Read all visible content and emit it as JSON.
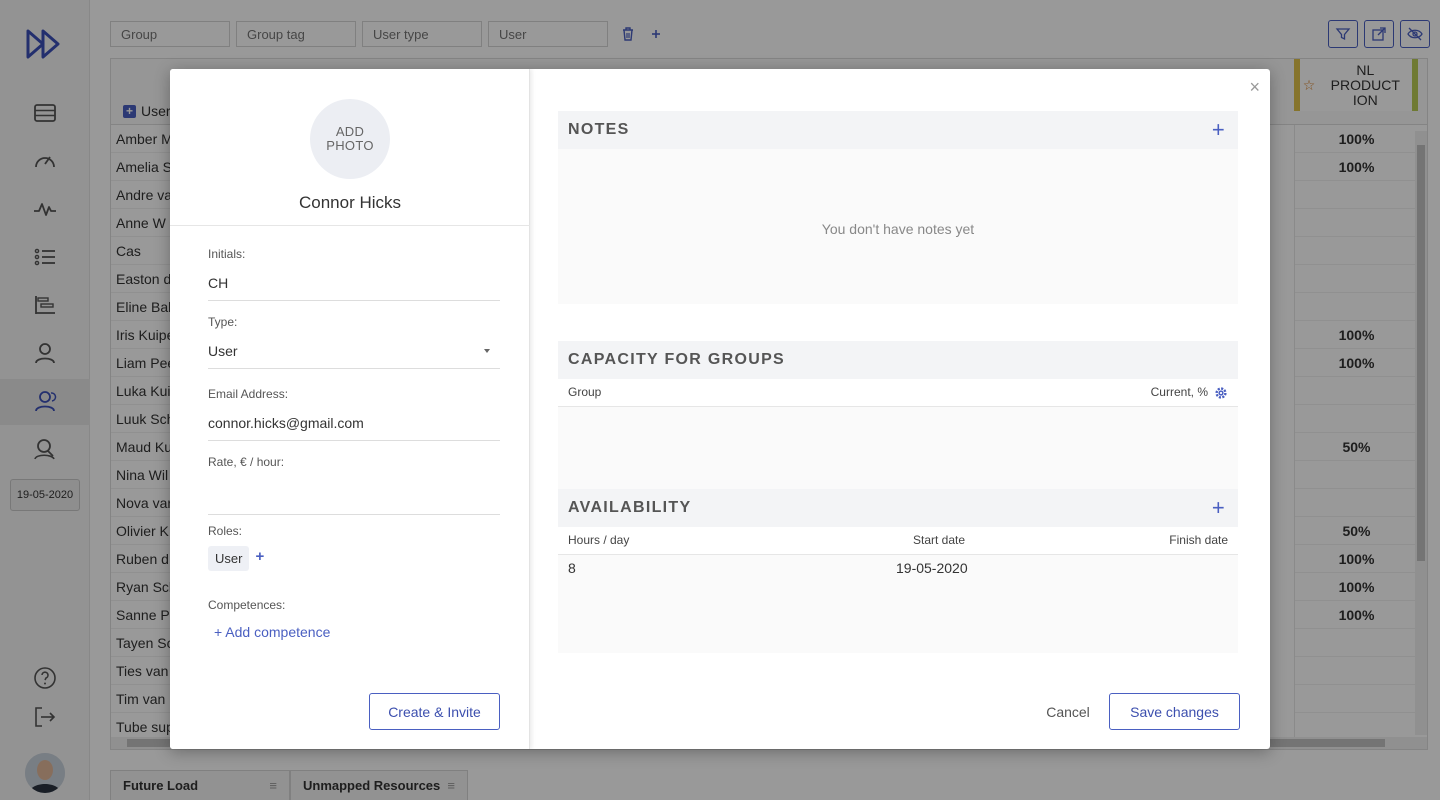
{
  "rail": {
    "date": "19-05-2020"
  },
  "toolbar": {
    "filters": [
      {
        "placeholder": "Group"
      },
      {
        "placeholder": "Group tag"
      },
      {
        "placeholder": "User type"
      },
      {
        "placeholder": "User"
      }
    ]
  },
  "grid": {
    "user_header": "User",
    "right_column_header": "NL PRODUCT ION",
    "rows": [
      {
        "name": "Amber M",
        "value": "100%"
      },
      {
        "name": "Amelia S",
        "value": "100%"
      },
      {
        "name": "Andre va",
        "value": ""
      },
      {
        "name": "Anne W",
        "value": ""
      },
      {
        "name": "Cas",
        "value": ""
      },
      {
        "name": "Easton d",
        "value": ""
      },
      {
        "name": "Eline Bak",
        "value": ""
      },
      {
        "name": "Iris Kuipe",
        "value": "100%"
      },
      {
        "name": "Liam Pee",
        "value": "100%"
      },
      {
        "name": "Luka Kui",
        "value": ""
      },
      {
        "name": "Luuk Sch",
        "value": ""
      },
      {
        "name": "Maud Ku",
        "value": "50%"
      },
      {
        "name": "Nina Wil",
        "value": ""
      },
      {
        "name": "Nova var",
        "value": ""
      },
      {
        "name": "Olivier K",
        "value": "50%"
      },
      {
        "name": "Ruben d",
        "value": "100%"
      },
      {
        "name": "Ryan Sch",
        "value": "100%"
      },
      {
        "name": "Sanne Pe",
        "value": "100%"
      },
      {
        "name": "Tayen Sc",
        "value": ""
      },
      {
        "name": "Ties van",
        "value": ""
      },
      {
        "name": "Tim van",
        "value": ""
      },
      {
        "name": "Tube sup",
        "value": ""
      }
    ]
  },
  "bottom_tabs": [
    {
      "label": "Future Load"
    },
    {
      "label": "Unmapped Resources"
    }
  ],
  "modal": {
    "photo_label": "ADD PHOTO",
    "full_name": "Connor Hicks",
    "fields": {
      "initials": {
        "label": "Initials:",
        "value": "CH"
      },
      "type": {
        "label": "Type:",
        "value": "User"
      },
      "email": {
        "label": "Email Address:",
        "value": "connor.hicks@gmail.com"
      },
      "rate": {
        "label": "Rate, € / hour:",
        "value": ""
      },
      "roles": {
        "label": "Roles:",
        "chips": [
          "User"
        ]
      },
      "competences": {
        "label": "Competences:",
        "add_label": "+ Add competence"
      }
    },
    "create_invite_label": "Create & Invite",
    "notes": {
      "title": "NOTES",
      "empty": "You don't have notes yet"
    },
    "capacity": {
      "title": "CAPACITY FOR GROUPS",
      "col_group": "Group",
      "col_current": "Current, %"
    },
    "availability": {
      "title": "AVAILABILITY",
      "col_hours": "Hours / day",
      "col_start": "Start date",
      "col_finish": "Finish date",
      "rows": [
        {
          "hours": "8",
          "start": "19-05-2020",
          "finish": ""
        }
      ]
    },
    "cancel_label": "Cancel",
    "save_label": "Save changes"
  },
  "colors": {
    "accent": "#4a5fc1"
  }
}
